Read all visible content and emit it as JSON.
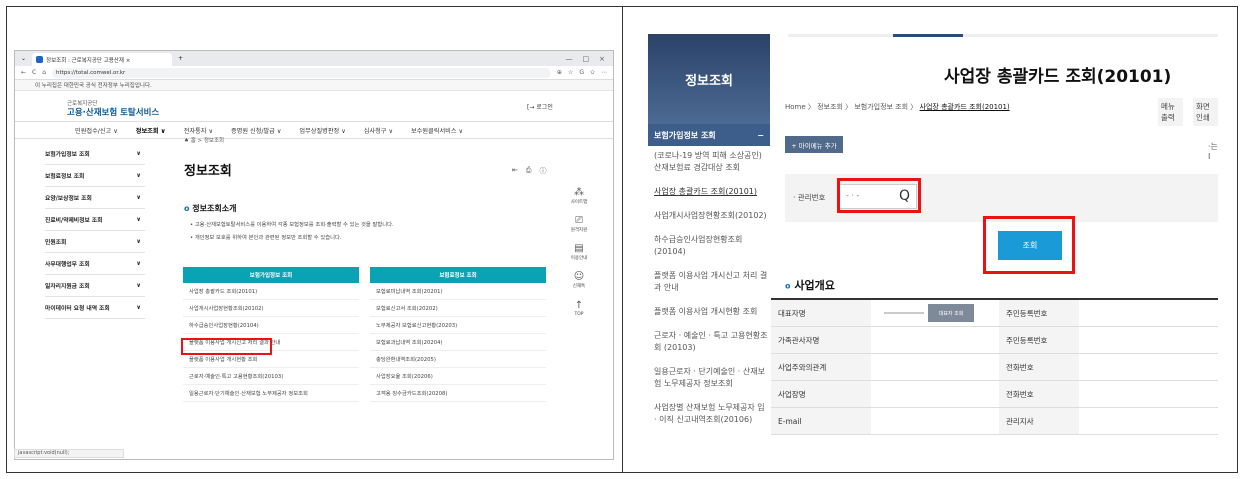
{
  "left": {
    "tab_title": "정보조회 : 근로복지공단 고용산재 ×",
    "url": "https://total.comwel.or.kr",
    "window_controls": [
      "—",
      "□",
      "×"
    ],
    "addr_icons": [
      "⊕",
      "☆",
      "G",
      "✩",
      "⋯"
    ],
    "gov_notice": "이 누리집은 대한민국 공식 전자정부 누리집입니다.",
    "logo_small": "근로복지공단",
    "logo_main": "고용·산재보험 토탈서비스",
    "login": "로그인",
    "gnb": [
      "민원접수/신고 ∨",
      "정보조회 ∨",
      "전자통지 ∨",
      "증명원 신청/발급 ∨",
      "업무상질병판정 ∨",
      "심사청구 ∨",
      "보수원클릭서비스 ∨"
    ],
    "lnb": [
      "보험가입정보 조회",
      "보험료정보 조회",
      "요양/보상정보 조회",
      "진료비/약제비정보 조회",
      "민원조회",
      "사무대행업무 조회",
      "일자리지원금 조회",
      "마이데이터 요청 내역 조회"
    ],
    "breadcrumb": "홈 > 정보조회",
    "page_title": "정보조회",
    "intro_title": "정보조회소개",
    "bullets": [
      "고용·산재보험토탈서비스를 이용하여 각종 보험정보를 조회·출력할 수 있는 것을 말합니다.",
      "개인정보 보호를 위하여 본인과 관련된 정보만 조회할 수 있습니다."
    ],
    "col1": {
      "head": "보험가입정보 조회",
      "items": [
        "사업장 총괄카드 조회(20101)",
        "사업개시사업장현황조회(20102)",
        "하수급승인사업장현황(20104)",
        "플랫폼 이용사업 개시신고 처리 결과 안내",
        "플랫폼 이용사업 개시현황 조회",
        "근로자·예술인·특고 고용현황조회(20103)",
        "일용근로자·단기예술인·산재보험 노무제공자 정보조회"
      ]
    },
    "col2": {
      "head": "보험료정보 조회",
      "items": [
        "보험료미납내역 조회(20201)",
        "보험료신고서 조회(20202)",
        "노무제공자 보험료신고현황(20203)",
        "보험료과납내역 조회(20204)",
        "충당완환내역조회(20205)",
        "사업장요율 조회(20206)",
        "고객용 징수금카드조회(20208)"
      ]
    },
    "quick": [
      "사이트맵",
      "원격지원",
      "이용안내",
      "신재톡",
      "TOP"
    ],
    "status": "javascript:void(null);"
  },
  "right": {
    "side_title": "정보조회",
    "side_sub": "보험가입정보 조회",
    "side_items": [
      "(코로나-19 방역 피해 소상공인) 산재보험료 경감대상 조회",
      "사업장 총괄카드 조회(20101)",
      "사업개시사업장현황조회(20102)",
      "하수급승인사업장현황조회(20104)",
      "플랫폼 이용사업 개시신고 처리 결과 안내",
      "플랫폼 이용사업 개시현황 조회",
      "근로자 · 예술인 · 특고 고용현황조회 (20103)",
      "일용근로자 · 단기예술인 · 산재보험 노무제공자 정보조회",
      "사업장별 산재보험 노무제공자 입 · 이직 신고내역조회(20106)"
    ],
    "title": "사업장 총괄카드 조회(20101)",
    "crumb_pre": "Home 〉 정보조회 〉 보험가입정보 조회 〉",
    "crumb_cur": "사업장 총괄카드 조회(20101)",
    "print_btns": [
      "메뉴출력",
      "화면인쇄"
    ],
    "my_menu": "+ 마이메뉴 추가",
    "misc": "·는 I",
    "search_label": "· 관리번호",
    "search_placeholder": "- · -",
    "search_button": "조회",
    "section": "사업개요",
    "gray_btn": "대표자 조회",
    "rows": [
      [
        "대표자명",
        "",
        "주민등록번호",
        ""
      ],
      [
        "가족관사자명",
        "",
        "주민등록번호",
        ""
      ],
      [
        "사업주와의관계",
        "",
        "전화번호",
        ""
      ],
      [
        "사업장명",
        "",
        "전화번호",
        ""
      ],
      [
        "E-mail",
        "",
        "관리지사",
        ""
      ]
    ]
  }
}
